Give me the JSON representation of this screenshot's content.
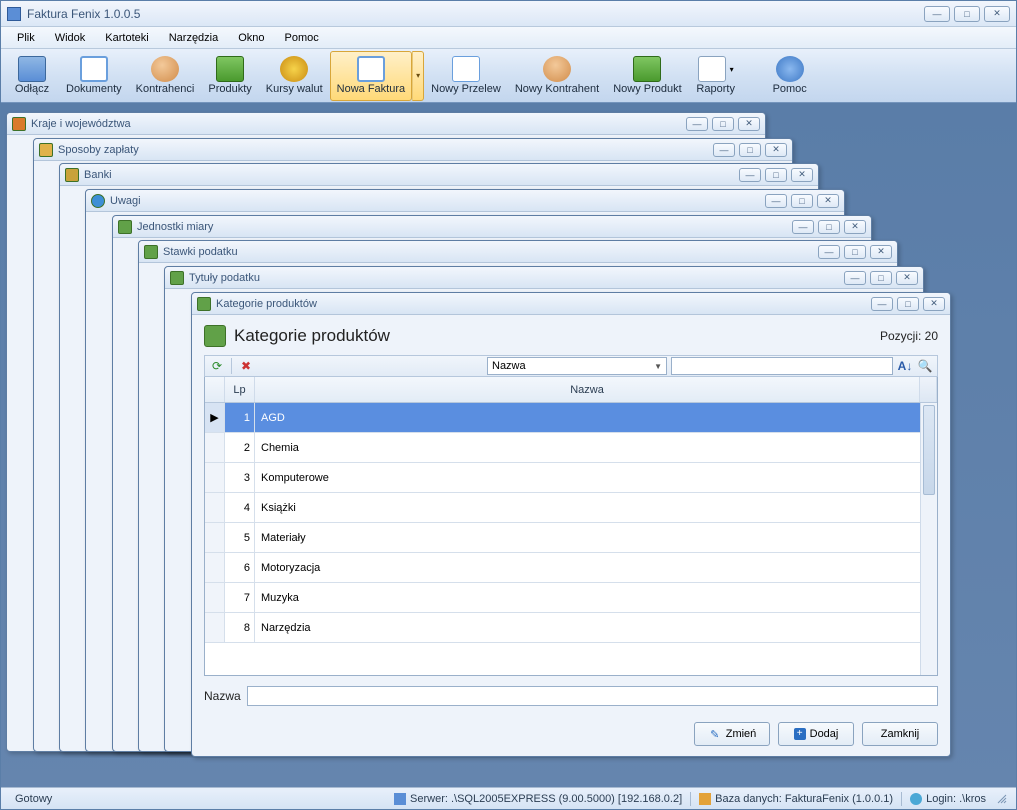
{
  "window": {
    "title": "Faktura Fenix 1.0.0.5"
  },
  "menu": {
    "plik": "Plik",
    "widok": "Widok",
    "kartoteki": "Kartoteki",
    "narzedzia": "Narzędzia",
    "okno": "Okno",
    "pomoc": "Pomoc"
  },
  "toolbar": {
    "odlacz": "Odłącz",
    "dokumenty": "Dokumenty",
    "kontrahenci": "Kontrahenci",
    "produkty": "Produkty",
    "kursywalut": "Kursy walut",
    "nowafaktura": "Nowa Faktura",
    "nowyprzelew": "Nowy Przelew",
    "nowykontrahent": "Nowy Kontrahent",
    "nowyprodukt": "Nowy Produkt",
    "raporty": "Raporty",
    "pomoc": "Pomoc"
  },
  "mdi": {
    "kraje": "Kraje i województwa",
    "sposoby": "Sposoby zapłaty",
    "banki": "Banki",
    "uwagi": "Uwagi",
    "jednostki": "Jednostki miary",
    "stawki": "Stawki podatku",
    "tytuly": "Tytuły podatku",
    "kategorie": "Kategorie produktów"
  },
  "activeWindow": {
    "title": "Kategorie produktów",
    "heading": "Kategorie produktów",
    "count_label": "Pozycji: 20",
    "filter_field": "Nazwa",
    "col_lp": "Lp",
    "col_name": "Nazwa",
    "rows": [
      {
        "lp": "1",
        "name": "AGD"
      },
      {
        "lp": "2",
        "name": "Chemia"
      },
      {
        "lp": "3",
        "name": "Komputerowe"
      },
      {
        "lp": "4",
        "name": "Książki"
      },
      {
        "lp": "5",
        "name": "Materiały"
      },
      {
        "lp": "6",
        "name": "Motoryzacja"
      },
      {
        "lp": "7",
        "name": "Muzyka"
      },
      {
        "lp": "8",
        "name": "Narzędzia"
      }
    ],
    "form_label": "Nazwa",
    "btn_zmien": "Zmień",
    "btn_dodaj": "Dodaj",
    "btn_zamknij": "Zamknij"
  },
  "status": {
    "ready": "Gotowy",
    "server": "Serwer: .\\SQL2005EXPRESS (9.00.5000) [192.168.0.2]",
    "db": "Baza danych: FakturaFenix (1.0.0.1)",
    "login": "Login: .\\kros"
  }
}
